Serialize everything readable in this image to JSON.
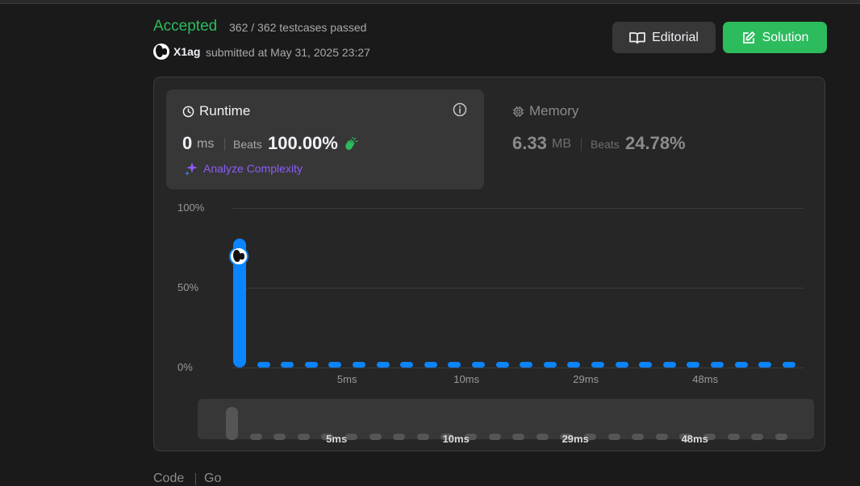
{
  "status": "Accepted",
  "testcases": "362 / 362 testcases passed",
  "user": {
    "name": "X1ag",
    "submitted": "submitted at May 31, 2025 23:27"
  },
  "buttons": {
    "editorial": "Editorial",
    "solution": "Solution"
  },
  "runtime": {
    "title": "Runtime",
    "value": "0",
    "unit": "ms",
    "beats_label": "Beats",
    "beats": "100.00%",
    "analyze": "Analyze Complexity"
  },
  "memory": {
    "title": "Memory",
    "value": "6.33",
    "unit": "MB",
    "beats_label": "Beats",
    "beats": "24.78%"
  },
  "code": {
    "label": "Code",
    "language": "Go"
  },
  "colors": {
    "accepted": "#2cbb5d",
    "bar": "#0a84ff",
    "analyze": "#8b5cf6",
    "panel": "#262626",
    "card": "#373737"
  },
  "icons": [
    "book-icon",
    "edit-icon",
    "clock-icon",
    "info-icon",
    "memory-chip-icon",
    "clap-icon",
    "sparkle-icon",
    "globe-avatar-icon"
  ],
  "chart_data": {
    "type": "bar",
    "title": "",
    "ylabel": "",
    "xlabel": "",
    "ytick_labels": [
      "100%",
      "50%",
      "0%"
    ],
    "ylim": [
      0,
      100
    ],
    "xtick_labels": [
      "5ms",
      "10ms",
      "29ms",
      "48ms"
    ],
    "series": [
      {
        "values": [
          81,
          0.5,
          0.5,
          0.5,
          0.5,
          0.5,
          0.5,
          0.5,
          0.5,
          0.5,
          0.5,
          0.5,
          0.5,
          0.5,
          0.5,
          0.5,
          0.5,
          0.5,
          0.5,
          0.5,
          0.5,
          0.5,
          0.5,
          0.5
        ]
      }
    ],
    "user_bar_index": 0,
    "grid": true
  }
}
